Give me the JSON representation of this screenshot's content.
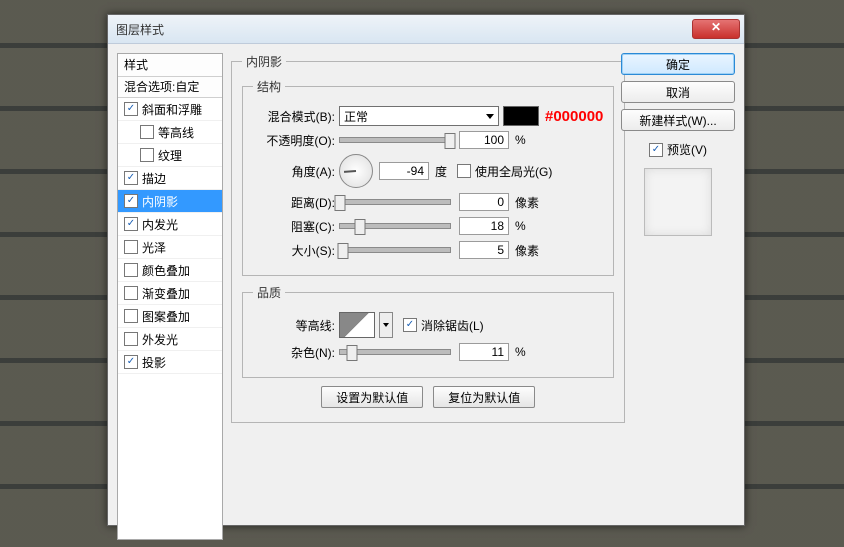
{
  "window": {
    "title": "图层样式"
  },
  "annotation": "#000000",
  "styles_panel": {
    "header": "样式",
    "sub": "混合选项:自定",
    "items": [
      {
        "label": "斜面和浮雕",
        "checked": true,
        "indent": false
      },
      {
        "label": "等高线",
        "checked": false,
        "indent": true
      },
      {
        "label": "纹理",
        "checked": false,
        "indent": true
      },
      {
        "label": "描边",
        "checked": true,
        "indent": false
      },
      {
        "label": "内阴影",
        "checked": true,
        "indent": false,
        "selected": true
      },
      {
        "label": "内发光",
        "checked": true,
        "indent": false
      },
      {
        "label": "光泽",
        "checked": false,
        "indent": false
      },
      {
        "label": "颜色叠加",
        "checked": false,
        "indent": false
      },
      {
        "label": "渐变叠加",
        "checked": false,
        "indent": false
      },
      {
        "label": "图案叠加",
        "checked": false,
        "indent": false
      },
      {
        "label": "外发光",
        "checked": false,
        "indent": false
      },
      {
        "label": "投影",
        "checked": true,
        "indent": false
      }
    ]
  },
  "groups": {
    "main_title": "内阴影",
    "structure": {
      "title": "结构",
      "blend_mode": {
        "label": "混合模式(B):",
        "value": "正常",
        "color": "#000000"
      },
      "opacity": {
        "label": "不透明度(O):",
        "value": "100",
        "unit": "%",
        "pct": 100
      },
      "angle": {
        "label": "角度(A):",
        "value": "-94",
        "unit": "度",
        "global": {
          "label": "使用全局光(G)",
          "checked": false
        }
      },
      "distance": {
        "label": "距离(D):",
        "value": "0",
        "unit": "像素",
        "pct": 0
      },
      "choke": {
        "label": "阻塞(C):",
        "value": "18",
        "unit": "%",
        "pct": 18
      },
      "size": {
        "label": "大小(S):",
        "value": "5",
        "unit": "像素",
        "pct": 3
      }
    },
    "quality": {
      "title": "品质",
      "contour": {
        "label": "等高线:",
        "antialias": {
          "label": "消除锯齿(L)",
          "checked": true
        }
      },
      "noise": {
        "label": "杂色(N):",
        "value": "11",
        "unit": "%",
        "pct": 11
      }
    },
    "buttons": {
      "default": "设置为默认值",
      "reset": "复位为默认值"
    }
  },
  "right": {
    "ok": "确定",
    "cancel": "取消",
    "new_style": "新建样式(W)...",
    "preview": {
      "label": "预览(V)",
      "checked": true
    }
  }
}
